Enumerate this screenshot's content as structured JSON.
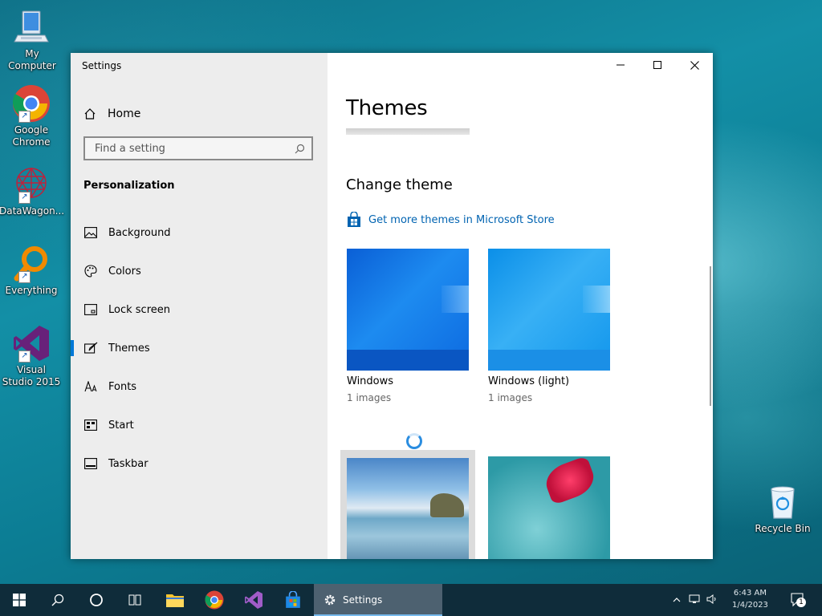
{
  "desktop": {
    "icons": [
      {
        "label": "My Computer"
      },
      {
        "label": "Google Chrome"
      },
      {
        "label": "DataWagon..."
      },
      {
        "label": "Everything"
      },
      {
        "label": "Visual Studio 2015"
      },
      {
        "label": "Recycle Bin"
      }
    ]
  },
  "window": {
    "app_title": "Settings",
    "sidebar": {
      "home_label": "Home",
      "search_placeholder": "Find a setting",
      "section_title": "Personalization",
      "items": [
        {
          "label": "Background",
          "icon": "image-icon"
        },
        {
          "label": "Colors",
          "icon": "palette-icon"
        },
        {
          "label": "Lock screen",
          "icon": "lock-screen-icon"
        },
        {
          "label": "Themes",
          "icon": "brush-icon",
          "selected": true
        },
        {
          "label": "Fonts",
          "icon": "fonts-icon"
        },
        {
          "label": "Start",
          "icon": "start-icon"
        },
        {
          "label": "Taskbar",
          "icon": "taskbar-icon"
        }
      ]
    },
    "main": {
      "page_title": "Themes",
      "change_theme_title": "Change theme",
      "store_link": "Get more themes in Microsoft Store",
      "themes": [
        {
          "name": "Windows",
          "count": "1 images"
        },
        {
          "name": "Windows (light)",
          "count": "1 images"
        }
      ]
    },
    "accent_color": "#0078d7"
  },
  "taskbar": {
    "settings_label": "Settings",
    "clock_time": "6:43 AM",
    "clock_date": "1/4/2023",
    "notification_count": "1"
  }
}
